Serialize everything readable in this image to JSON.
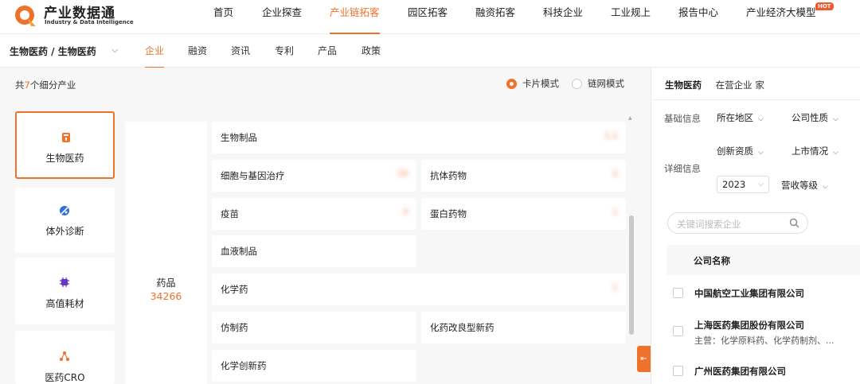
{
  "brand": {
    "title": "产业数据通",
    "subtitle": "Industry & Data Intelligence"
  },
  "top_menu": [
    {
      "label": "首页"
    },
    {
      "label": "企业探查"
    },
    {
      "label": "产业链拓客",
      "active": true
    },
    {
      "label": "园区拓客"
    },
    {
      "label": "融资拓客"
    },
    {
      "label": "科技企业"
    },
    {
      "label": "工业规上"
    },
    {
      "label": "报告中心"
    },
    {
      "label": "产业经济大模型",
      "badge": "HOT"
    }
  ],
  "subnav": {
    "breadcrumb": "生物医药 / 生物医药",
    "tabs": [
      {
        "label": "企业",
        "active": true
      },
      {
        "label": "融资"
      },
      {
        "label": "资讯"
      },
      {
        "label": "专利"
      },
      {
        "label": "产品"
      },
      {
        "label": "政策"
      }
    ]
  },
  "summary": {
    "prefix": "共",
    "count": "7",
    "suffix": "个细分产业"
  },
  "view_modes": {
    "card": "卡片模式",
    "chain": "链网模式",
    "selected": "card"
  },
  "categories": [
    {
      "label": "生物医药",
      "icon": "medicine-bottle-icon",
      "active": true
    },
    {
      "label": "体外诊断",
      "icon": "diagnosis-icon"
    },
    {
      "label": "高值耗材",
      "icon": "chip-icon"
    },
    {
      "label": "医药CRO",
      "icon": "network-icon"
    }
  ],
  "group": {
    "name": "药品",
    "count": "34266"
  },
  "sub_industries": [
    {
      "label": "生物制品",
      "value": "1,1"
    },
    {
      "label": "细胞与基因治疗",
      "value": "56"
    },
    {
      "label": "抗体药物",
      "value": "2"
    },
    {
      "label": "疫苗",
      "value": "4"
    },
    {
      "label": "蛋白药物",
      "value": "1"
    },
    {
      "label": "血液制品",
      "value": ""
    },
    {
      "label": "化学药",
      "value": "1"
    },
    {
      "label": "仿制药",
      "value": ""
    },
    {
      "label": "化药改良型新药",
      "value": ""
    },
    {
      "label": "化学创新药",
      "value": ""
    }
  ],
  "right_panel": {
    "industry": "生物医药",
    "in_business_label": "在营企业",
    "in_business_count": "",
    "unit": "家",
    "basic_info_label": "基础信息",
    "detail_info_label": "详细信息",
    "filters": {
      "region": "所在地区",
      "company_type": "公司性质",
      "innovation": "创新资质",
      "listing": "上市情况",
      "year": "2023",
      "revenue": "营收等级"
    },
    "search_placeholder": "关键词搜索企业",
    "table_header": "公司名称",
    "companies": [
      {
        "name": "中国航空工业集团有限公司",
        "desc": ""
      },
      {
        "name": "上海医药集团股份有限公司",
        "desc": "主营：化学原料药、化学药制剂、..."
      },
      {
        "name": "广州医药集团有限公司",
        "desc": ""
      }
    ]
  },
  "colors": {
    "accent": "#f0712c",
    "panel_bg": "#f7f7f8"
  }
}
